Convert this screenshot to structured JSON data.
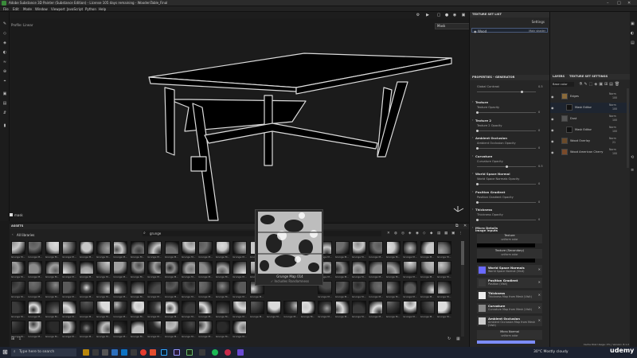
{
  "window": {
    "title": "Adobe Substance 3D Painter (Substance Edition) - License 105 days remaining - WoodenTable_Final",
    "controls": [
      "–",
      "□",
      "✕"
    ]
  },
  "menu": [
    "File",
    "Edit",
    "Mode",
    "Window",
    "Viewport",
    "JavaScript",
    "Python",
    "Help"
  ],
  "viewport": {
    "profile_label": "Profile: Linear",
    "mode_value": "Mask",
    "status_label": "mask"
  },
  "assets": {
    "title": "ASSETS",
    "library": "All libraries",
    "search_value": "grunge",
    "thumb_caption": "Grunge M...",
    "preview_name": "Grunge Map 014",
    "preview_sub": "Includes Randomness"
  },
  "texture_set_list": {
    "title": "TEXTURE SET LIST",
    "settings": "Settings",
    "item": "Wood",
    "shader": "Main shader"
  },
  "properties": {
    "title": "PROPERTIES - GENERATOR",
    "global_contrast_label": "Global Contrast",
    "global_contrast_value": "0.5",
    "sections": [
      {
        "name": "Texture",
        "prop": "Texture Opacity",
        "value": "0"
      },
      {
        "name": "Texture 2",
        "prop": "Texture 2 Opacity",
        "value": "0"
      },
      {
        "name": "Ambient Occlusion",
        "prop": "Ambient Occlusion Opacity",
        "value": "0"
      },
      {
        "name": "Curvature",
        "prop": "Curvature Opacity",
        "value": "0.5"
      },
      {
        "name": "World Space Normal",
        "prop": "World Space Normals Opacity",
        "value": "0"
      },
      {
        "name": "Position Gradient",
        "prop": "Position Gradient Opacity",
        "value": "0"
      },
      {
        "name": "Thickness",
        "prop": "Thickness Opacity",
        "value": "0"
      },
      {
        "name": "Micro Details",
        "prop": "",
        "value": ""
      }
    ],
    "image_inputs_title": "Image inputs",
    "slots": [
      {
        "name": "Texture",
        "sub": "uniform color"
      },
      {
        "name": "Texture (Secondary)",
        "sub": "uniform color"
      }
    ],
    "inputs": [
      {
        "name": "World Space Normals",
        "sub": "World Space Normal (Visit)"
      },
      {
        "name": "Position Gradient",
        "sub": "Position (Visit)"
      },
      {
        "name": "Thickness",
        "sub": "Thickness Map from Mesh (Visit)"
      },
      {
        "name": "Curvature",
        "sub": "Curvature Map from Mesh (Visit)"
      },
      {
        "name": "Ambient Occlusion",
        "sub": "Ambient Occlusion Map from Mesh (Visit)"
      }
    ],
    "micro_normal": "Micro Normal",
    "micro_normal_sub": "uniform color"
  },
  "layers": {
    "title": "LAYERS",
    "tab2": "TEXTURE SET SETTINGS",
    "blend_mode": "Base color",
    "rows": [
      {
        "name": "Edges",
        "mode": "Norm",
        "value": "100"
      },
      {
        "name": "Mask Editor",
        "mode": "Norm",
        "value": "100"
      },
      {
        "name": "Dust",
        "mode": "Norm",
        "value": "100"
      },
      {
        "name": "Mask Editor",
        "mode": "Norm",
        "value": "100"
      },
      {
        "name": "Wood Overlay",
        "mode": "Norm",
        "value": "21"
      },
      {
        "name": "Wood American Cherry",
        "mode": "Norm",
        "value": "100"
      }
    ]
  },
  "taskbar": {
    "search_placeholder": "Type here to search",
    "weather": "30°C  Mostly cloudy",
    "status_text": "Cache Disk Usage: 0%  |  Version: 8.1.2",
    "brand": "udemy"
  }
}
